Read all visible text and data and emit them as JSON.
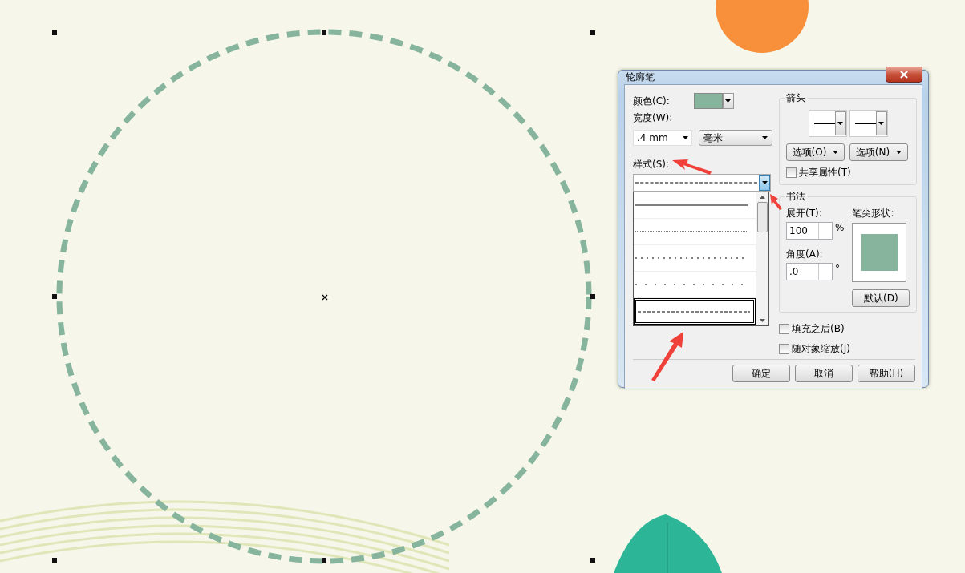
{
  "dialog": {
    "title": "轮廓笔",
    "color_field": {
      "label": "颜色(C):",
      "color": "#86b49c"
    },
    "width": {
      "label": "宽度(W):",
      "value": ".4 mm",
      "unit": "毫米"
    },
    "style": {
      "label": "样式(S):",
      "expanded": true,
      "options": [
        {
          "kind": "solid",
          "selected": false
        },
        {
          "kind": "fine-dotted",
          "selected": false
        },
        {
          "kind": "dotted",
          "selected": false
        },
        {
          "kind": "sparse-dotted",
          "selected": false
        },
        {
          "kind": "dashed",
          "selected": true
        }
      ]
    },
    "arrows": {
      "title": "箭头",
      "option_buttons": [
        "选项(O)",
        "选项(N)"
      ],
      "shared": {
        "label": "共享属性(T)",
        "checked": false
      }
    },
    "calligraphy": {
      "title": "书法",
      "stretch": {
        "label": "展开(T):",
        "value": "100",
        "unit": "%"
      },
      "angle": {
        "label": "角度(A):",
        "value": ".0",
        "unit": "°"
      },
      "nib_label": "笔尖形状:",
      "default_button": "默认(D)"
    },
    "behind_fill": {
      "label": "填充之后(B)",
      "checked": false
    },
    "scale_with_object": {
      "label": "随对象缩放(J)",
      "checked": false
    },
    "buttons": [
      "确定",
      "取消",
      "帮助(H)"
    ]
  }
}
